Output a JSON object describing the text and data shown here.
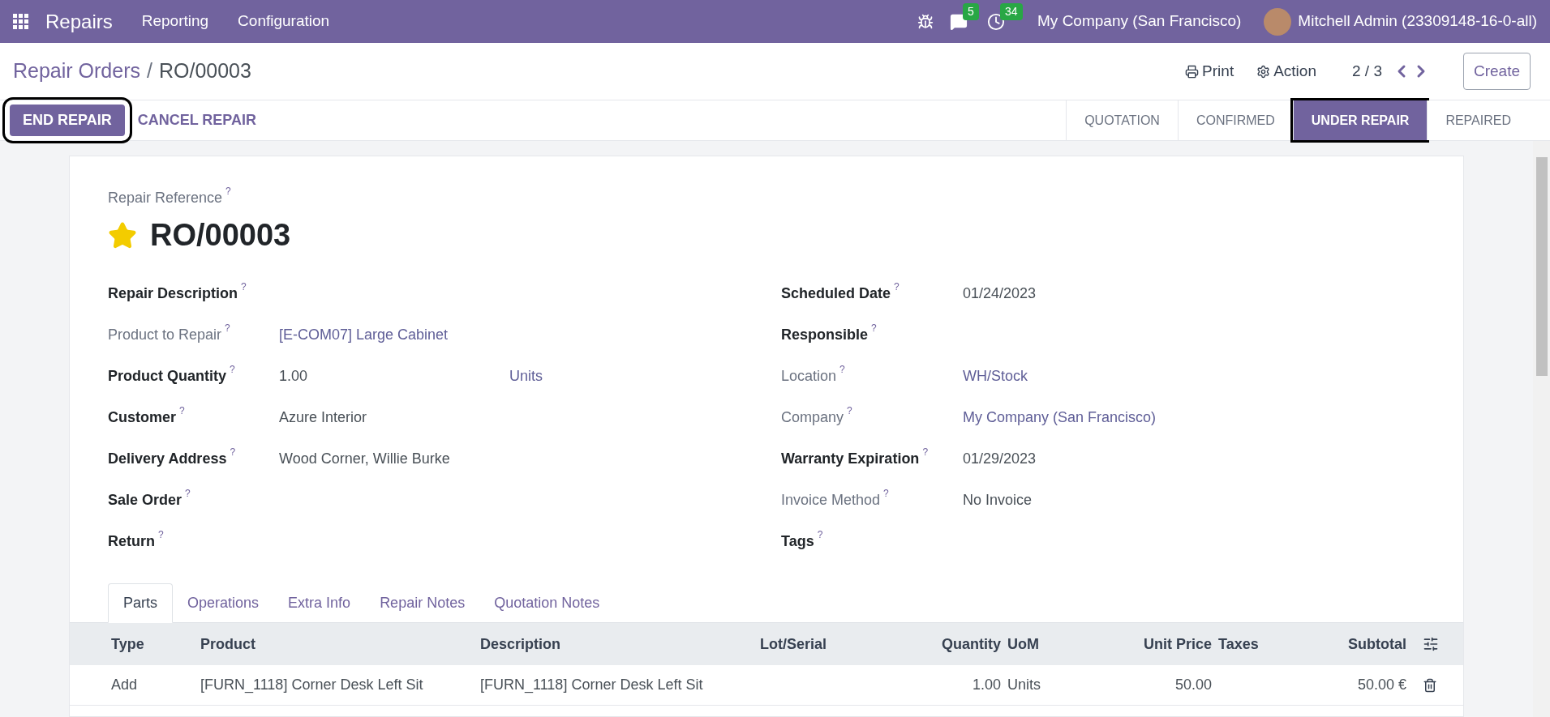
{
  "navbar": {
    "app": "Repairs",
    "menus": [
      "Reporting",
      "Configuration"
    ],
    "messages_count": "5",
    "activities_count": "34",
    "company": "My Company (San Francisco)",
    "user": "Mitchell Admin (23309148-16-0-all)"
  },
  "breadcrumb": {
    "parent": "Repair Orders",
    "separator": "/",
    "current": "RO/00003"
  },
  "control": {
    "print": "Print",
    "action": "Action",
    "pager": "2 / 3",
    "create": "Create"
  },
  "actions": [
    {
      "label": "END REPAIR",
      "kind": "primary",
      "highlighted": true
    },
    {
      "label": "CANCEL REPAIR",
      "kind": "link",
      "highlighted": false
    }
  ],
  "stages": [
    {
      "label": "QUOTATION",
      "selected": false,
      "highlighted": false
    },
    {
      "label": "CONFIRMED",
      "selected": false,
      "highlighted": false
    },
    {
      "label": "UNDER REPAIR",
      "selected": true,
      "highlighted": true
    },
    {
      "label": "REPAIRED",
      "selected": false,
      "highlighted": false
    }
  ],
  "form": {
    "reference_label": "Repair Reference",
    "help": "?",
    "starred": true,
    "name": "RO/00003",
    "left_fields": [
      {
        "label": "Repair Description",
        "muted": false
      },
      {
        "label": "Product to Repair",
        "muted": true,
        "value": "[E-COM07] Large Cabinet",
        "link": true
      },
      {
        "label": "Product Quantity",
        "muted": false,
        "value": "1.00",
        "link": false,
        "unit": "Units"
      },
      {
        "label": "Customer",
        "muted": false,
        "value": "Azure Interior",
        "link": false
      },
      {
        "label": "Delivery Address",
        "muted": false,
        "value": "Wood Corner, Willie Burke",
        "link": false
      },
      {
        "label": "Sale Order",
        "muted": false
      },
      {
        "label": "Return",
        "muted": false
      }
    ],
    "right_fields": [
      {
        "label": "Scheduled Date",
        "muted": false,
        "value": "01/24/2023",
        "link": false
      },
      {
        "label": "Responsible",
        "muted": false
      },
      {
        "label": "Location",
        "muted": true,
        "value": "WH/Stock",
        "link": true
      },
      {
        "label": "Company",
        "muted": true,
        "value": "My Company (San Francisco)",
        "link": true
      },
      {
        "label": "Warranty Expiration",
        "muted": false,
        "value": "01/29/2023",
        "link": false
      },
      {
        "label": "Invoice Method",
        "muted": true,
        "value": "No Invoice",
        "link": false
      },
      {
        "label": "Tags",
        "muted": false
      }
    ]
  },
  "tabs": [
    {
      "label": "Parts",
      "selected": true
    },
    {
      "label": "Operations",
      "selected": false
    },
    {
      "label": "Extra Info",
      "selected": false
    },
    {
      "label": "Repair Notes",
      "selected": false
    },
    {
      "label": "Quotation Notes",
      "selected": false
    }
  ],
  "table": {
    "columns": [
      "Type",
      "Product",
      "Description",
      "Lot/Serial",
      "Quantity",
      "UoM",
      "Unit Price",
      "Taxes",
      "Subtotal"
    ],
    "rows": [
      [
        "Add",
        "[FURN_1118] Corner Desk Left Sit",
        "[FURN_1118] Corner Desk Left Sit",
        "",
        "1.00",
        "Units",
        "50.00",
        "",
        "50.00 €"
      ]
    ]
  }
}
